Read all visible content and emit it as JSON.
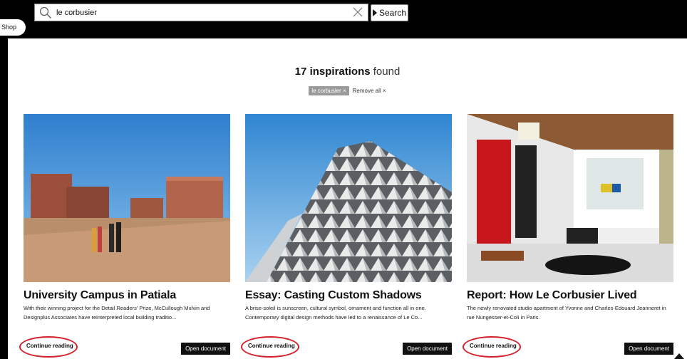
{
  "search": {
    "value": "le corbusier",
    "button_label": "Search"
  },
  "shop_tab": "Shop",
  "results": {
    "count": "17",
    "noun": "inspirations",
    "suffix": "found"
  },
  "filters": {
    "chips": [
      "le corbusier ×"
    ],
    "remove_all": "Remove all ×"
  },
  "cards": [
    {
      "title": "University Campus in Patiala",
      "excerpt": "With their winning project for the Detail Readers' Prize, McCullough Mulvin and Designplus Associates have reinterpreted local building traditio...",
      "continue_label": "Continue reading",
      "open_label": "Open document"
    },
    {
      "title": "Essay: Casting Custom Shadows",
      "excerpt": "A brise-soleil is sunscreen, cultural symbol, ornament and function all in one. Contemporary digital design methods have led to a renaissance of Le Co...",
      "continue_label": "Continue reading",
      "open_label": "Open document"
    },
    {
      "title": "Report: How Le Corbusier Lived",
      "excerpt": "The newly renovated studio apartment of Yvonne and Charles-Edouard Jeanneret in rue Nungesser-et-Coli in Paris.",
      "continue_label": "Continue reading",
      "open_label": "Open document"
    }
  ],
  "colors": {
    "topbar": "#000000",
    "highlight": "#d4202a",
    "button_dark": "#111111"
  }
}
